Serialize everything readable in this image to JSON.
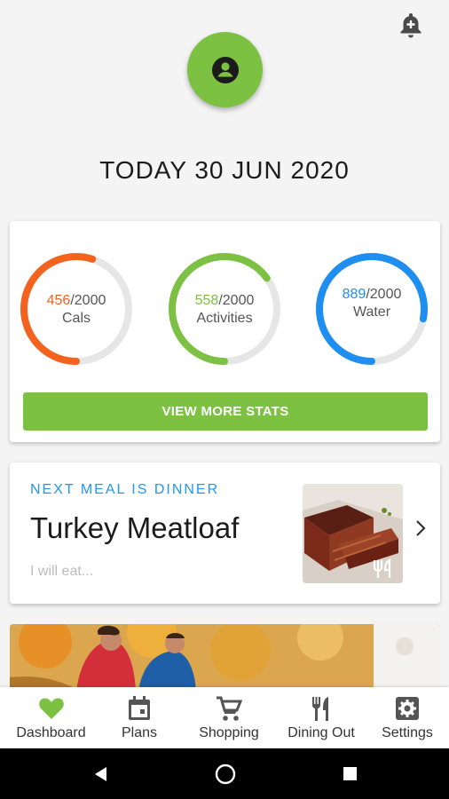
{
  "header": {
    "date_title": "TODAY 30 JUN 2020",
    "accent_color": "#7cc142"
  },
  "stats": {
    "rings": [
      {
        "value": "456",
        "goal": "/2000",
        "label": "Cals",
        "progress": 0.55,
        "color": "#f4621f",
        "icon": "calories-ring"
      },
      {
        "value": "558",
        "goal": "/2000",
        "label": "Activities",
        "progress": 0.65,
        "color": "#7cc142",
        "icon": "activities-ring"
      },
      {
        "value": "889",
        "goal": "/2000",
        "label": "Water",
        "progress": 0.78,
        "color": "#1e8ff0",
        "icon": "water-ring"
      }
    ],
    "button_label": "VIEW MORE STATS"
  },
  "meal": {
    "eyebrow": "NEXT MEAL IS DINNER",
    "name": "Turkey Meatloaf",
    "placeholder": "I will eat..."
  },
  "nav": {
    "items": [
      {
        "label": "Dashboard",
        "icon": "heart-icon",
        "active": true
      },
      {
        "label": "Plans",
        "icon": "calendar-icon"
      },
      {
        "label": "Shopping",
        "icon": "cart-icon"
      },
      {
        "label": "Dining Out",
        "icon": "utensils-icon"
      },
      {
        "label": "Settings",
        "icon": "gear-icon"
      }
    ]
  }
}
